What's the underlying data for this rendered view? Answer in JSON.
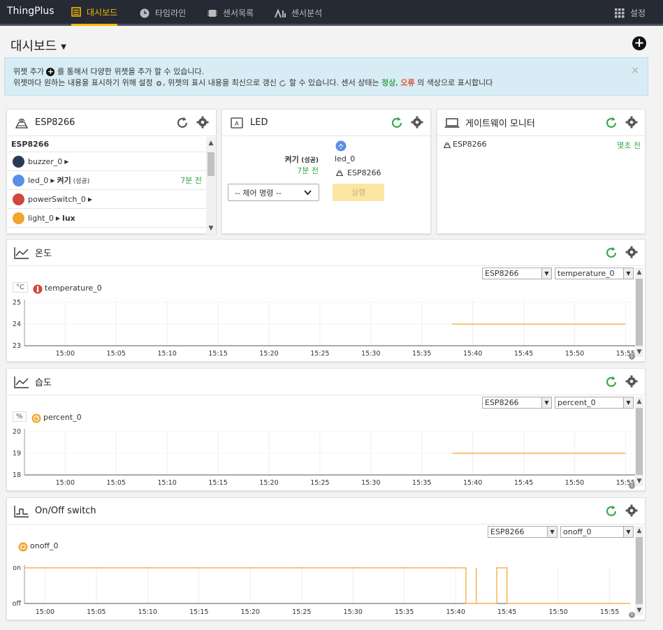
{
  "topbar": {
    "brand": "ThingPlus",
    "nav": [
      {
        "label": "대시보드",
        "icon": "dashboard-icon",
        "active": true
      },
      {
        "label": "타임라인",
        "icon": "clock-icon",
        "active": false
      },
      {
        "label": "센서목록",
        "icon": "sensor-list-icon",
        "active": false
      },
      {
        "label": "센서분석",
        "icon": "analytics-icon",
        "active": false
      }
    ],
    "settings_label": "설정"
  },
  "page": {
    "title": "대시보드"
  },
  "info": {
    "line1_a": "위젯 추가",
    "line1_b": "를 통해서 다양한 위젯을 추가 할 수 있습니다.",
    "line2_a": "위젯마다 원하는 내용을 표시하기 위해 설정",
    "line2_b": ", 위젯의 표시 내용을 최신으로 갱신",
    "line2_c": "할 수 있습니다. 센서 상태는",
    "status_ok": "정상",
    "comma": ",",
    "status_err": "오류",
    "line2_d": "의 색상으로 표시합니다",
    "close": "×"
  },
  "gateway_widget": {
    "title": "ESP8266",
    "header_row": "ESP8266",
    "rows": [
      {
        "name": "buzzer_0",
        "value": "",
        "sub": "",
        "time": "",
        "color": "#2a3a55"
      },
      {
        "name": "led_0",
        "value": "켜기",
        "sub": "(성공)",
        "time": "7분 전",
        "color": "#5b8ee6"
      },
      {
        "name": "powerSwitch_0",
        "value": "",
        "sub": "",
        "time": "",
        "color": "#d0473c"
      },
      {
        "name": "light_0",
        "value": "lux",
        "sub": "",
        "time": "",
        "color": "#f3a52a"
      }
    ]
  },
  "led_widget": {
    "title": "LED",
    "state": "켜기",
    "state_sub": "(성공)",
    "time": "7분 전",
    "sensor": "led_0",
    "device": "ESP8266",
    "command_placeholder": "-- 제어 명령 --",
    "run_label": "실행"
  },
  "monitor_widget": {
    "title": "게이트웨이 모니터",
    "device": "ESP8266",
    "time": "몇초 전"
  },
  "x_ticks": [
    "15:00",
    "15:05",
    "15:10",
    "15:15",
    "15:20",
    "15:25",
    "15:30",
    "15:35",
    "15:40",
    "15:45",
    "15:50",
    "15:55"
  ],
  "temp_widget": {
    "title": "온도",
    "unit": "°C",
    "sensor": "temperature_0",
    "device_select": "ESP8266",
    "sensor_select": "temperature_0"
  },
  "humid_widget": {
    "title": "습도",
    "unit": "%",
    "sensor": "percent_0",
    "device_select": "ESP8266",
    "sensor_select": "percent_0"
  },
  "switch_widget": {
    "title": "On/Off switch",
    "sensor": "onoff_0",
    "device_select": "ESP8266",
    "sensor_select": "onoff_0"
  },
  "chart_data": [
    {
      "type": "line",
      "title": "온도",
      "series": [
        {
          "name": "temperature_0",
          "points": [
            [
              "15:38",
              24
            ],
            [
              "15:55",
              24
            ]
          ]
        }
      ],
      "y_ticks": [
        23,
        24,
        25
      ],
      "ylim": [
        23,
        25
      ],
      "x_range": [
        "14:56",
        "15:56"
      ],
      "color": "#f3a52a",
      "grid": true
    },
    {
      "type": "line",
      "title": "습도",
      "series": [
        {
          "name": "percent_0",
          "points": [
            [
              "15:38",
              19
            ],
            [
              "15:55",
              19
            ]
          ]
        }
      ],
      "y_ticks": [
        18,
        19,
        20
      ],
      "ylim": [
        18,
        20
      ],
      "x_range": [
        "14:56",
        "15:56"
      ],
      "color": "#f3a52a",
      "grid": true
    },
    {
      "type": "line",
      "title": "On/Off switch",
      "series": [
        {
          "name": "onoff_0",
          "points": [
            [
              "14:58",
              "on"
            ],
            [
              "15:41",
              "on"
            ],
            [
              "15:41",
              "off"
            ],
            [
              "15:42",
              "off"
            ],
            [
              "15:42",
              "on"
            ],
            [
              "15:42",
              "off"
            ],
            [
              "15:44",
              "off"
            ],
            [
              "15:44",
              "on"
            ],
            [
              "15:45",
              "on"
            ],
            [
              "15:45",
              "off"
            ],
            [
              "15:57",
              "off"
            ]
          ]
        }
      ],
      "y_ticks": [
        "on",
        "off"
      ],
      "x_range": [
        "14:58",
        "15:57"
      ],
      "color": "#f3a52a",
      "grid": true
    }
  ]
}
